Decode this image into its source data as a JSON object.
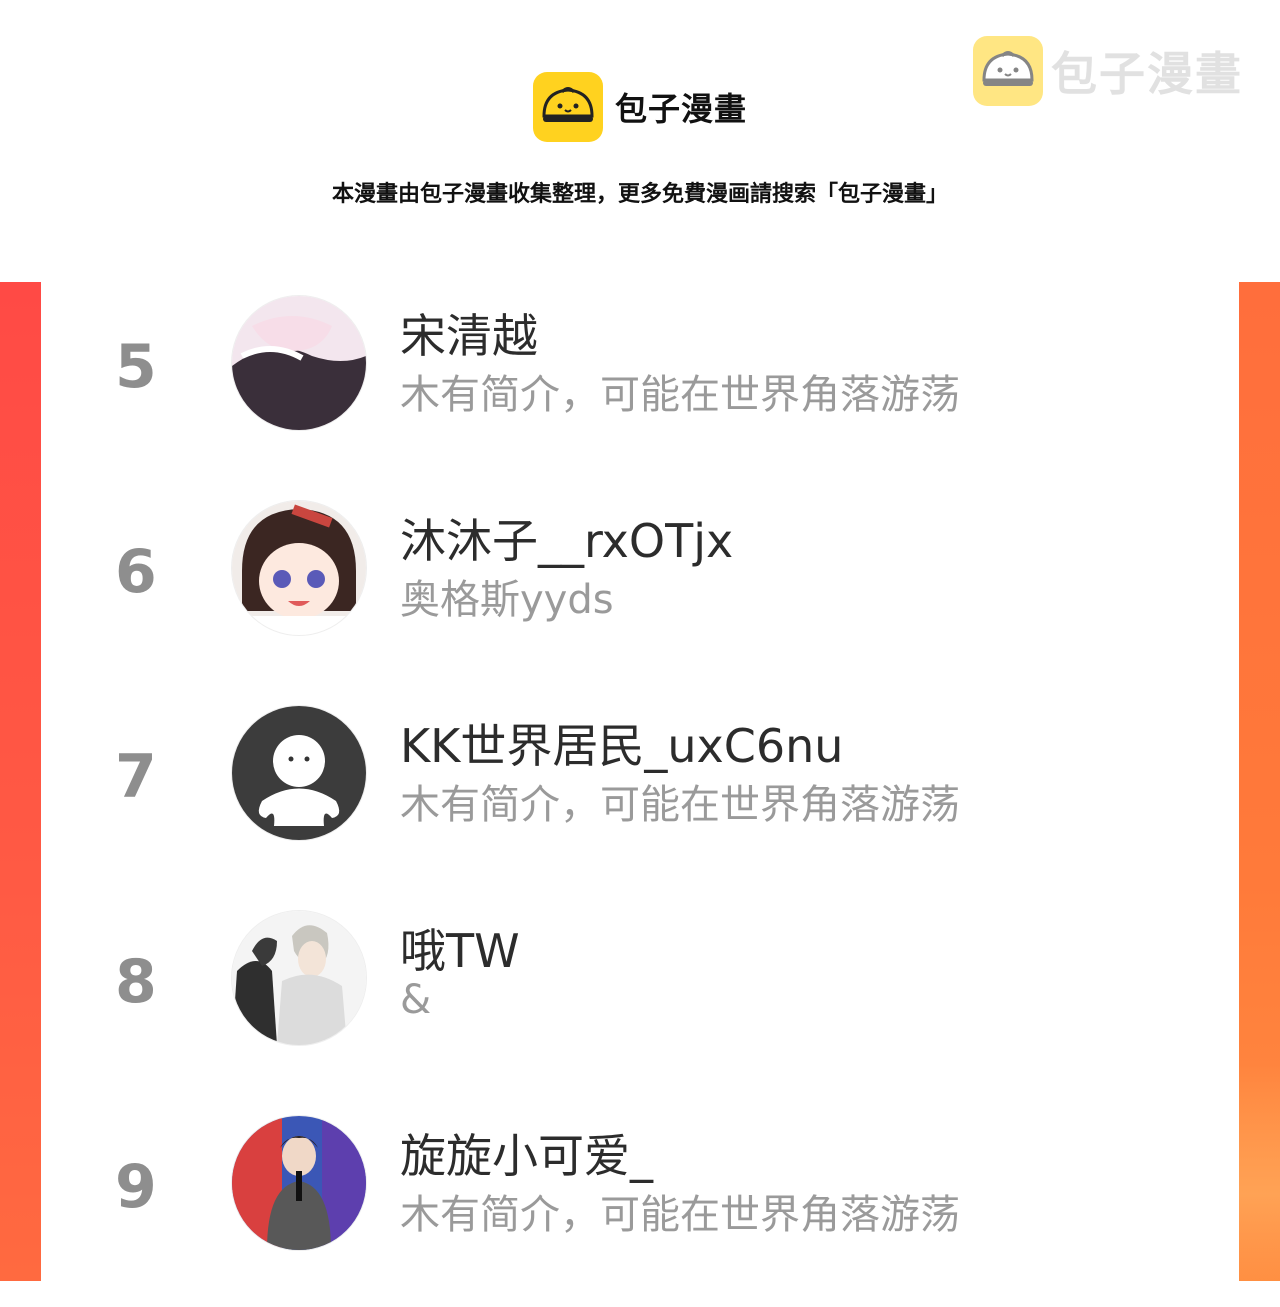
{
  "header": {
    "brand_name": "包子漫畫",
    "watermark_text": "包子漫畫",
    "notice": "本漫畫由包子漫畫收集整理，更多免費漫画請搜索「包子漫畫」",
    "logo_icon": "bun-icon",
    "brand_color": "#ffd21f"
  },
  "colors": {
    "band_left": "#ff4a45",
    "band_right": "#ff7a3a",
    "rank": "#8e8e8e",
    "bio": "#9a9a9a"
  },
  "rankings": [
    {
      "rank": "5",
      "name": "宋清越",
      "bio": "木有简介，可能在世界角落游荡"
    },
    {
      "rank": "6",
      "name": "沐沐子__rxOTjx",
      "bio": "奥格斯yyds"
    },
    {
      "rank": "7",
      "name": "KK世界居民_uxC6nu",
      "bio": "木有简介，可能在世界角落游荡"
    },
    {
      "rank": "8",
      "name": "哦TW",
      "bio": "&"
    },
    {
      "rank": "9",
      "name": "旋旋小可爱_",
      "bio": "木有简介，可能在世界角落游荡"
    }
  ]
}
